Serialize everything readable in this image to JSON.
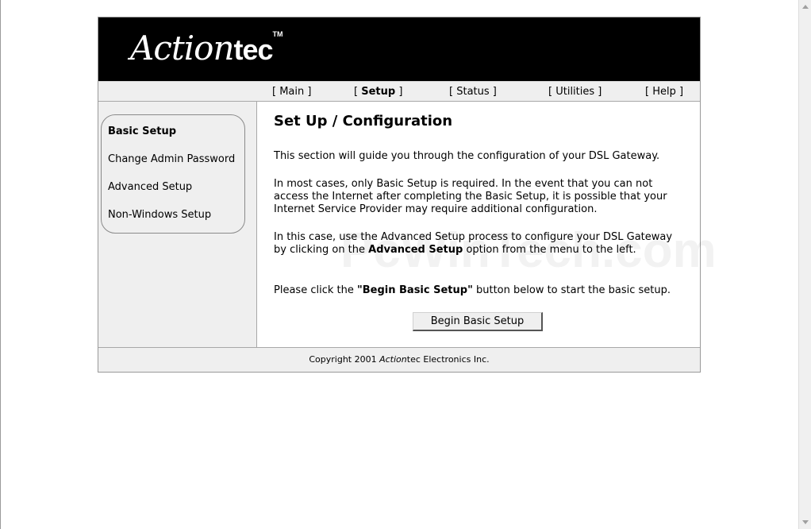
{
  "brand": {
    "logo_script": "Action",
    "logo_block": "tec",
    "logo_tm": "TM"
  },
  "nav": {
    "items": [
      {
        "label": "Main",
        "active": false
      },
      {
        "label": "Setup",
        "active": true
      },
      {
        "label": "Status",
        "active": false
      },
      {
        "label": "Utilities",
        "active": false
      },
      {
        "label": "Help",
        "active": false
      }
    ],
    "bracket_open": "[ ",
    "bracket_close": " ]"
  },
  "sidebar": {
    "items": [
      {
        "label": "Basic Setup",
        "active": true
      },
      {
        "label": "Change Admin Password",
        "active": false
      },
      {
        "label": "Advanced Setup",
        "active": false
      },
      {
        "label": "Non-Windows Setup",
        "active": false
      }
    ]
  },
  "content": {
    "title": "Set Up / Configuration",
    "p1": "This section will guide you through the configuration of your DSL Gateway.",
    "p2": "In most cases, only Basic Setup is required. In the event that you can not access the Internet after completing the Basic Setup, it is possible that your Internet Service Provider may require additional configuration.",
    "p3_before": "In this case, use the Advanced Setup process to configure your DSL Gateway by clicking on the ",
    "p3_bold": "Advanced Setup",
    "p3_after": " option from the menu to the left.",
    "p4_before": "Please click the ",
    "p4_bold": "\"Begin Basic Setup\"",
    "p4_after": " button below to start the basic setup.",
    "button_label": "Begin Basic Setup",
    "watermark": "PcWinTech.com"
  },
  "footer": {
    "prefix": "Copyright 2001 ",
    "brand_italic": "Action",
    "brand_rest": "tec",
    "suffix": " Electronics Inc."
  }
}
